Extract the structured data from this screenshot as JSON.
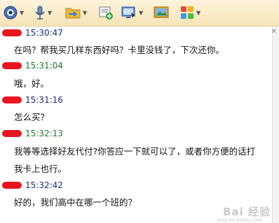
{
  "toolbar": {
    "buttons": [
      {
        "icon": "webcam-icon"
      },
      {
        "icon": "microphone-icon"
      },
      {
        "icon": "folder-icon"
      },
      {
        "icon": "message-add-icon"
      },
      {
        "icon": "screen-share-icon"
      },
      {
        "icon": "image-icon"
      },
      {
        "icon": "apps-grid-icon"
      }
    ]
  },
  "messages": [
    {
      "time": "15:30:47",
      "sender": "self",
      "text": "在吗？帮我买几样东西好吗？卡里没钱了，下次还你。"
    },
    {
      "time": "15:31:04",
      "sender": "peer",
      "text": "哦，好。"
    },
    {
      "time": "15:31:16",
      "sender": "self",
      "text": "怎么买？"
    },
    {
      "time": "15:32:13",
      "sender": "peer",
      "text": "我等等选择好友代付?你答应一下就可以了，或者你方便的话打",
      "text2": "我卡上也行。"
    },
    {
      "time": "15:32:42",
      "sender": "self",
      "text": "好的，我们高中在哪一个班的？"
    }
  ],
  "watermark": {
    "text": "Bai 经验",
    "sub": "jingyan.baidu.com"
  }
}
